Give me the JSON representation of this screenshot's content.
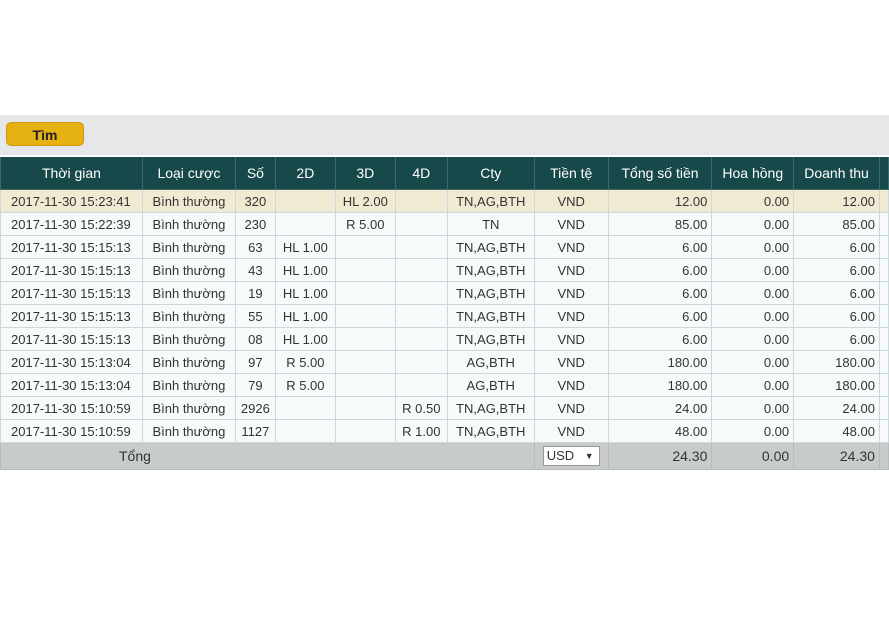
{
  "toolbar": {
    "search_label": "Tìm"
  },
  "columns": [
    "Thời gian",
    "Loại cược",
    "Số",
    "2D",
    "3D",
    "4D",
    "Cty",
    "Tiền tệ",
    "Tổng số tiền",
    "Hoa hồng",
    "Doanh thu"
  ],
  "rows": [
    [
      "2017-11-30 15:23:41",
      "Bình thường",
      "320",
      "",
      "HL 2.00",
      "",
      "TN,AG,BTH",
      "VND",
      "12.00",
      "0.00",
      "12.00"
    ],
    [
      "2017-11-30 15:22:39",
      "Bình thường",
      "230",
      "",
      "R 5.00",
      "",
      "TN",
      "VND",
      "85.00",
      "0.00",
      "85.00"
    ],
    [
      "2017-11-30 15:15:13",
      "Bình thường",
      "63",
      "HL 1.00",
      "",
      "",
      "TN,AG,BTH",
      "VND",
      "6.00",
      "0.00",
      "6.00"
    ],
    [
      "2017-11-30 15:15:13",
      "Bình thường",
      "43",
      "HL 1.00",
      "",
      "",
      "TN,AG,BTH",
      "VND",
      "6.00",
      "0.00",
      "6.00"
    ],
    [
      "2017-11-30 15:15:13",
      "Bình thường",
      "19",
      "HL 1.00",
      "",
      "",
      "TN,AG,BTH",
      "VND",
      "6.00",
      "0.00",
      "6.00"
    ],
    [
      "2017-11-30 15:15:13",
      "Bình thường",
      "55",
      "HL 1.00",
      "",
      "",
      "TN,AG,BTH",
      "VND",
      "6.00",
      "0.00",
      "6.00"
    ],
    [
      "2017-11-30 15:15:13",
      "Bình thường",
      "08",
      "HL 1.00",
      "",
      "",
      "TN,AG,BTH",
      "VND",
      "6.00",
      "0.00",
      "6.00"
    ],
    [
      "2017-11-30 15:13:04",
      "Bình thường",
      "97",
      "R 5.00",
      "",
      "",
      "AG,BTH",
      "VND",
      "180.00",
      "0.00",
      "180.00"
    ],
    [
      "2017-11-30 15:13:04",
      "Bình thường",
      "79",
      "R 5.00",
      "",
      "",
      "AG,BTH",
      "VND",
      "180.00",
      "0.00",
      "180.00"
    ],
    [
      "2017-11-30 15:10:59",
      "Bình thường",
      "2926",
      "",
      "",
      "R 0.50",
      "TN,AG,BTH",
      "VND",
      "24.00",
      "0.00",
      "24.00"
    ],
    [
      "2017-11-30 15:10:59",
      "Bình thường",
      "1127",
      "",
      "",
      "R 1.00",
      "TN,AG,BTH",
      "VND",
      "48.00",
      "0.00",
      "48.00"
    ]
  ],
  "footer": {
    "label": "Tổng",
    "currency": "USD",
    "caret": "▼",
    "total": "24.30",
    "commission": "0.00",
    "revenue": "24.30"
  },
  "colors": {
    "header_bg": "#17494a",
    "search_button": "#e6b112",
    "selected_row": "#f1ead3",
    "footer_bg": "#c8cbcc"
  }
}
